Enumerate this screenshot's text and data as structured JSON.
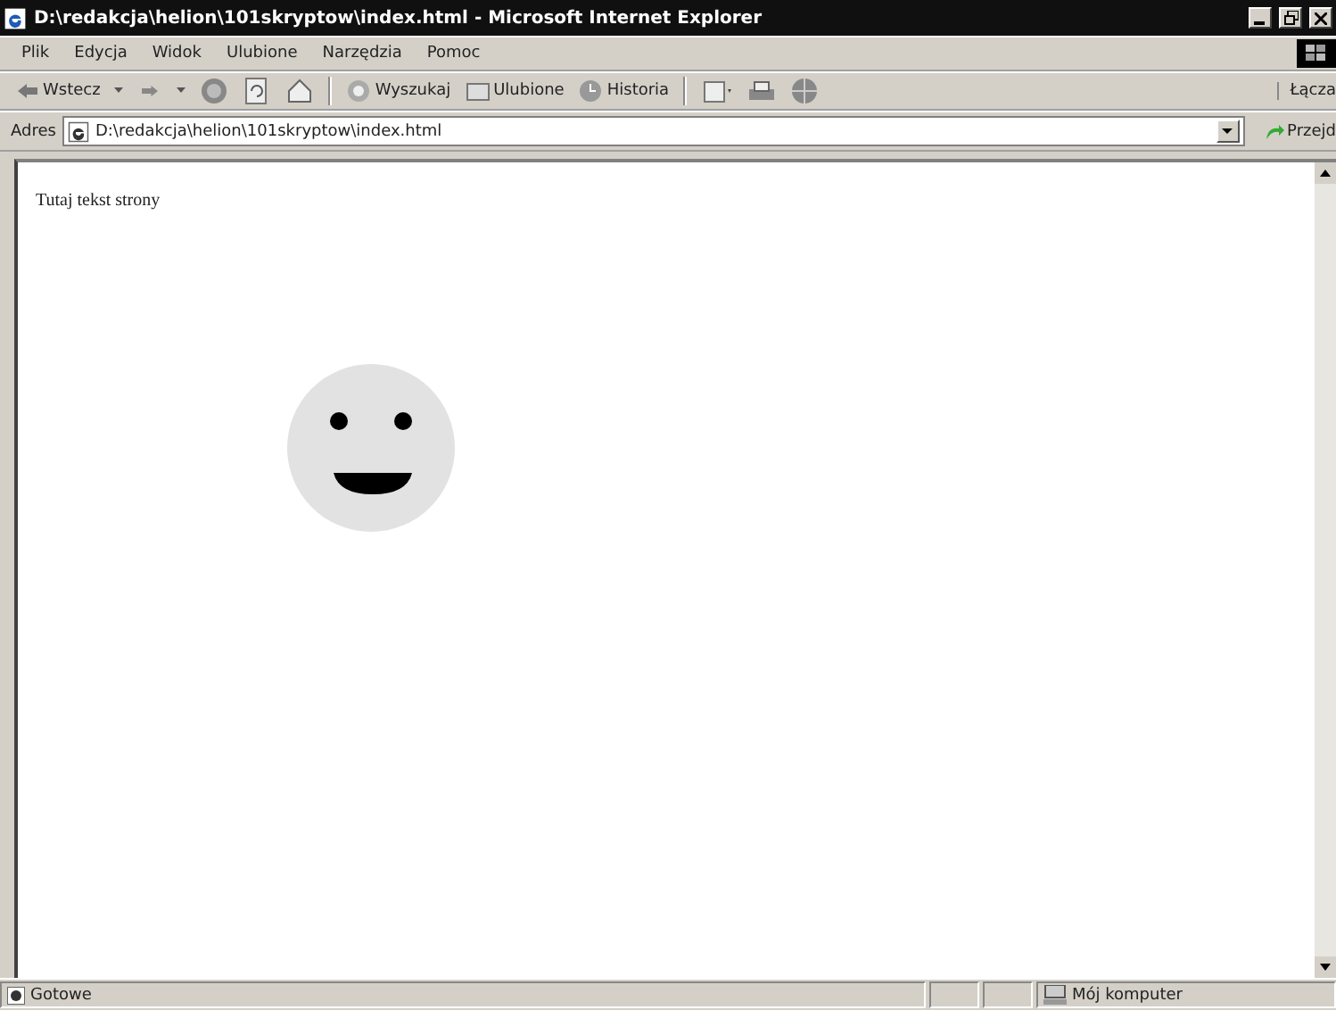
{
  "window": {
    "title": "D:\\redakcja\\helion\\101skryptow\\index.html - Microsoft Internet Explorer"
  },
  "menu": [
    "Plik",
    "Edycja",
    "Widok",
    "Ulubione",
    "Narzędzia",
    "Pomoc"
  ],
  "toolbar": {
    "back": "Wstecz",
    "search": "Wyszukaj",
    "favorites": "Ulubione",
    "history": "Historia",
    "links": "Łącza"
  },
  "address": {
    "label": "Adres",
    "value": "D:\\redakcja\\helion\\101skryptow\\index.html",
    "go": "Przejd"
  },
  "page": {
    "text": "Tutaj tekst strony"
  },
  "status_bar": {
    "message": "Gotowe",
    "zone": "Mój komputer"
  }
}
